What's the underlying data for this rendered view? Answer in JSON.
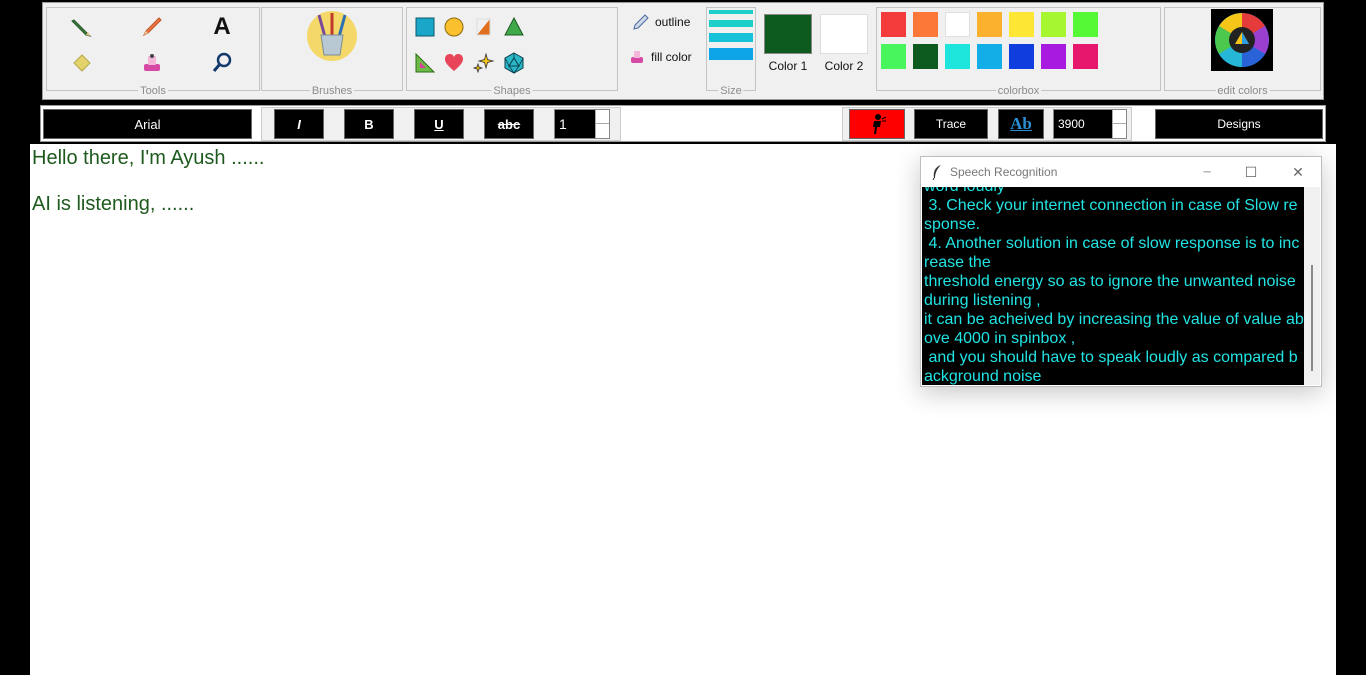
{
  "ribbon": {
    "groups": {
      "tools": "Tools",
      "brushes": "Brushes",
      "shapes": "Shapes",
      "size": "Size",
      "colorbox": "colorbox",
      "edit_colors": "edit colors"
    },
    "tools": [
      {
        "icon": "pencil-icon"
      },
      {
        "icon": "pen-icon"
      },
      {
        "icon": "text-icon",
        "glyph": "A"
      },
      {
        "icon": "eraser-icon"
      },
      {
        "icon": "fill-bucket-icon"
      },
      {
        "icon": "magnifier-icon"
      }
    ],
    "brushes_icon": "brushes-cup-icon",
    "shapes": [
      "square-icon",
      "circle-icon",
      "right-triangle-icon",
      "triangle-icon",
      "triangle-ruler-icon",
      "heart-icon",
      "sparkles-icon",
      "polyhedron-icon"
    ],
    "outline_label": "outline",
    "fill_label": "fill color",
    "size_colors": [
      "#1ccfc9",
      "#1ccfc9",
      "#15c2d8",
      "#0ea4e8"
    ],
    "color1_label": "Color 1",
    "color1_value": "#0d5a1f",
    "color2_label": "Color 2",
    "color2_value": "#ffffff",
    "colorbox": [
      "#f43b3b",
      "#fb7839",
      "#ffffff",
      "#fbb12e",
      "#fee634",
      "#a6f630",
      "#54f835",
      "#48f55c",
      "#0d5a1f",
      "#1de5db",
      "#13aee8",
      "#0f3dde",
      "#a81ae0",
      "#e6176d"
    ]
  },
  "toolbar": {
    "font": "Arial",
    "italic": "I",
    "bold": "B",
    "underline": "U",
    "strike": "abc",
    "font_size": "1",
    "trace": "Trace",
    "text_style": "Ab",
    "threshold": "3900",
    "designs": "Designs",
    "mic_button_color": "#ff0000"
  },
  "canvas": {
    "line1": "Hello there, I'm Ayush ......",
    "line2": "AI is listening, ......",
    "text_color": "#1e5a1e"
  },
  "dialog": {
    "title": "Speech Recognition",
    "minimize": "─",
    "maximize": "☐",
    "close": "✕",
    "text": "word loudly\n 3. Check your internet connection in case of Slow response.\n 4. Another solution in case of slow response is to increase the\nthreshold energy so as to ignore the unwanted noise during listening ,\nit can be acheived by increasing the value of value above 4000 in spinbox ,\n and you should have to speak loudly as compared background noise",
    "text_color": "#22e4e4"
  }
}
